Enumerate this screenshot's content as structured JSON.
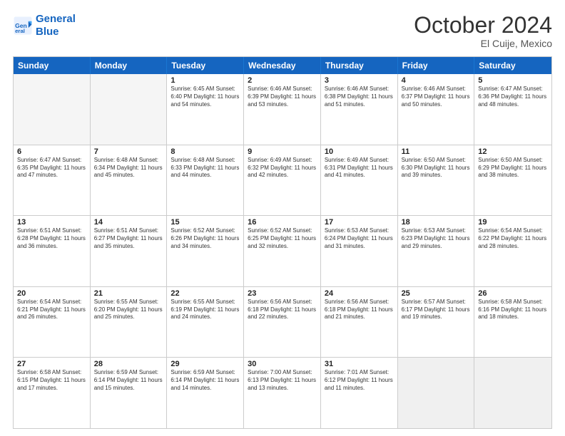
{
  "logo": {
    "line1": "General",
    "line2": "Blue"
  },
  "title": "October 2024",
  "subtitle": "El Cuije, Mexico",
  "days": [
    "Sunday",
    "Monday",
    "Tuesday",
    "Wednesday",
    "Thursday",
    "Friday",
    "Saturday"
  ],
  "rows": [
    [
      {
        "day": "",
        "info": ""
      },
      {
        "day": "",
        "info": ""
      },
      {
        "day": "1",
        "info": "Sunrise: 6:45 AM\nSunset: 6:40 PM\nDaylight: 11 hours and 54 minutes."
      },
      {
        "day": "2",
        "info": "Sunrise: 6:46 AM\nSunset: 6:39 PM\nDaylight: 11 hours and 53 minutes."
      },
      {
        "day": "3",
        "info": "Sunrise: 6:46 AM\nSunset: 6:38 PM\nDaylight: 11 hours and 51 minutes."
      },
      {
        "day": "4",
        "info": "Sunrise: 6:46 AM\nSunset: 6:37 PM\nDaylight: 11 hours and 50 minutes."
      },
      {
        "day": "5",
        "info": "Sunrise: 6:47 AM\nSunset: 6:36 PM\nDaylight: 11 hours and 48 minutes."
      }
    ],
    [
      {
        "day": "6",
        "info": "Sunrise: 6:47 AM\nSunset: 6:35 PM\nDaylight: 11 hours and 47 minutes."
      },
      {
        "day": "7",
        "info": "Sunrise: 6:48 AM\nSunset: 6:34 PM\nDaylight: 11 hours and 45 minutes."
      },
      {
        "day": "8",
        "info": "Sunrise: 6:48 AM\nSunset: 6:33 PM\nDaylight: 11 hours and 44 minutes."
      },
      {
        "day": "9",
        "info": "Sunrise: 6:49 AM\nSunset: 6:32 PM\nDaylight: 11 hours and 42 minutes."
      },
      {
        "day": "10",
        "info": "Sunrise: 6:49 AM\nSunset: 6:31 PM\nDaylight: 11 hours and 41 minutes."
      },
      {
        "day": "11",
        "info": "Sunrise: 6:50 AM\nSunset: 6:30 PM\nDaylight: 11 hours and 39 minutes."
      },
      {
        "day": "12",
        "info": "Sunrise: 6:50 AM\nSunset: 6:29 PM\nDaylight: 11 hours and 38 minutes."
      }
    ],
    [
      {
        "day": "13",
        "info": "Sunrise: 6:51 AM\nSunset: 6:28 PM\nDaylight: 11 hours and 36 minutes."
      },
      {
        "day": "14",
        "info": "Sunrise: 6:51 AM\nSunset: 6:27 PM\nDaylight: 11 hours and 35 minutes."
      },
      {
        "day": "15",
        "info": "Sunrise: 6:52 AM\nSunset: 6:26 PM\nDaylight: 11 hours and 34 minutes."
      },
      {
        "day": "16",
        "info": "Sunrise: 6:52 AM\nSunset: 6:25 PM\nDaylight: 11 hours and 32 minutes."
      },
      {
        "day": "17",
        "info": "Sunrise: 6:53 AM\nSunset: 6:24 PM\nDaylight: 11 hours and 31 minutes."
      },
      {
        "day": "18",
        "info": "Sunrise: 6:53 AM\nSunset: 6:23 PM\nDaylight: 11 hours and 29 minutes."
      },
      {
        "day": "19",
        "info": "Sunrise: 6:54 AM\nSunset: 6:22 PM\nDaylight: 11 hours and 28 minutes."
      }
    ],
    [
      {
        "day": "20",
        "info": "Sunrise: 6:54 AM\nSunset: 6:21 PM\nDaylight: 11 hours and 26 minutes."
      },
      {
        "day": "21",
        "info": "Sunrise: 6:55 AM\nSunset: 6:20 PM\nDaylight: 11 hours and 25 minutes."
      },
      {
        "day": "22",
        "info": "Sunrise: 6:55 AM\nSunset: 6:19 PM\nDaylight: 11 hours and 24 minutes."
      },
      {
        "day": "23",
        "info": "Sunrise: 6:56 AM\nSunset: 6:18 PM\nDaylight: 11 hours and 22 minutes."
      },
      {
        "day": "24",
        "info": "Sunrise: 6:56 AM\nSunset: 6:18 PM\nDaylight: 11 hours and 21 minutes."
      },
      {
        "day": "25",
        "info": "Sunrise: 6:57 AM\nSunset: 6:17 PM\nDaylight: 11 hours and 19 minutes."
      },
      {
        "day": "26",
        "info": "Sunrise: 6:58 AM\nSunset: 6:16 PM\nDaylight: 11 hours and 18 minutes."
      }
    ],
    [
      {
        "day": "27",
        "info": "Sunrise: 6:58 AM\nSunset: 6:15 PM\nDaylight: 11 hours and 17 minutes."
      },
      {
        "day": "28",
        "info": "Sunrise: 6:59 AM\nSunset: 6:14 PM\nDaylight: 11 hours and 15 minutes."
      },
      {
        "day": "29",
        "info": "Sunrise: 6:59 AM\nSunset: 6:14 PM\nDaylight: 11 hours and 14 minutes."
      },
      {
        "day": "30",
        "info": "Sunrise: 7:00 AM\nSunset: 6:13 PM\nDaylight: 11 hours and 13 minutes."
      },
      {
        "day": "31",
        "info": "Sunrise: 7:01 AM\nSunset: 6:12 PM\nDaylight: 11 hours and 11 minutes."
      },
      {
        "day": "",
        "info": ""
      },
      {
        "day": "",
        "info": ""
      }
    ]
  ]
}
